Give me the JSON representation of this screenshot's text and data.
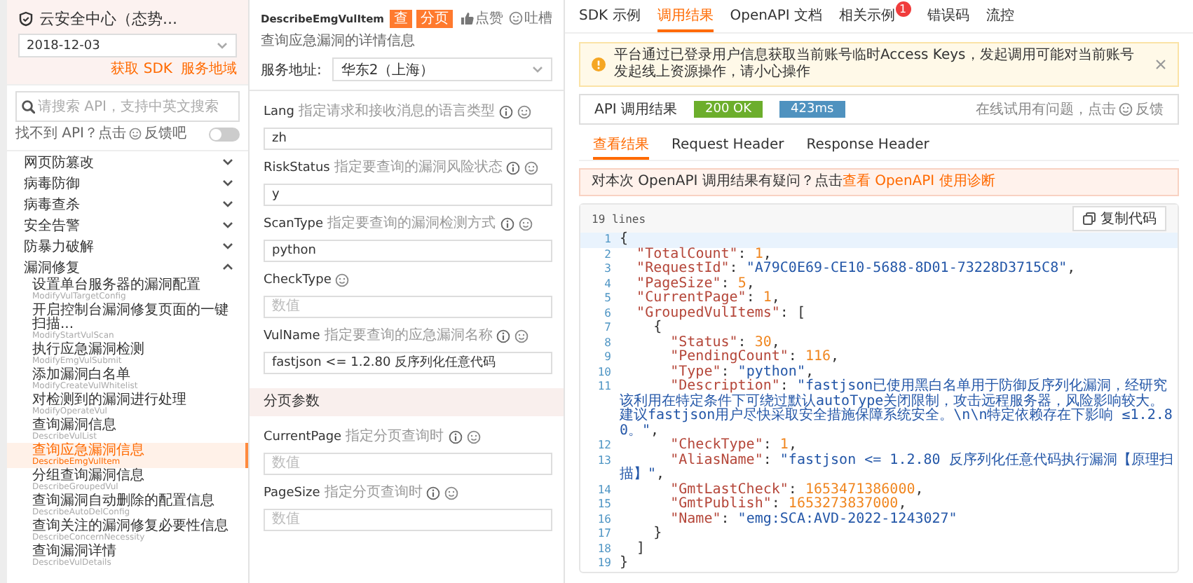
{
  "sidebar": {
    "title": "云安全中心（态势...",
    "version": "2018-12-03",
    "links": [
      "获取 SDK",
      "服务地域"
    ],
    "search": {
      "placeholder": "请搜索 API，支持中英文搜索"
    },
    "hint": {
      "text": "找不到 API？点击",
      "link": "反馈吧"
    },
    "mode_toggle_on": false,
    "categories": [
      {
        "name": "网页防篡改",
        "expanded": false
      },
      {
        "name": "病毒防御",
        "expanded": false
      },
      {
        "name": "病毒查杀",
        "expanded": false
      },
      {
        "name": "安全告警",
        "expanded": false
      },
      {
        "name": "防暴力破解",
        "expanded": false
      },
      {
        "name": "漏洞修复",
        "expanded": true,
        "children": [
          {
            "name": "设置单台服务器的漏洞配置",
            "api": "ModifyVulTargetConfig",
            "selected": false
          },
          {
            "name": "开启控制台漏洞修复页面的一键扫描...",
            "api": "ModifyStartVulScan",
            "selected": false
          },
          {
            "name": "执行应急漏洞检测",
            "api": "ModifyEmgVulSubmit",
            "selected": false
          },
          {
            "name": "添加漏洞白名单",
            "api": "ModifyCreateVulWhitelist",
            "selected": false
          },
          {
            "name": "对检测到的漏洞进行处理",
            "api": "ModifyOperateVul",
            "selected": false
          },
          {
            "name": "查询漏洞信息",
            "api": "DescribeVulList",
            "selected": false
          },
          {
            "name": "查询应急漏洞信息",
            "api": "DescribeEmgVulItem",
            "selected": true
          },
          {
            "name": "分组查询漏洞信息",
            "api": "DescribeGroupedVul",
            "selected": false
          },
          {
            "name": "查询漏洞自动删除的配置信息",
            "api": "DescribeAutoDelConfig",
            "selected": false
          },
          {
            "name": "查询关注的漏洞修复必要性信息",
            "api": "DescribeConcernNecessity",
            "selected": false
          },
          {
            "name": "查询漏洞详情",
            "api": "DescribeVulDetails",
            "selected": false
          }
        ]
      }
    ]
  },
  "api": {
    "name": "DescribeEmgVulItem",
    "tags": [
      "查",
      "分页"
    ],
    "actions": [
      {
        "kind": "like",
        "label": "点赞"
      },
      {
        "kind": "complain",
        "label": "吐槽"
      }
    ],
    "description": "查询应急漏洞的详情信息",
    "endpoint": {
      "label": "服务地址:",
      "value": "华东2（上海）"
    },
    "params": [
      {
        "name": "Lang",
        "description": "指定请求和接收消息的语言类型",
        "info": true,
        "value": "zh"
      },
      {
        "name": "RiskStatus",
        "description": "指定要查询的漏洞风险状态",
        "info": true,
        "value": "y"
      },
      {
        "name": "ScanType",
        "description": "指定要查询的漏洞检测方式",
        "info": true,
        "value": "python"
      },
      {
        "name": "CheckType",
        "info": false,
        "placeholder": "数值"
      },
      {
        "name": "VulName",
        "description": "指定要查询的应急漏洞名称",
        "info": true,
        "value": "fastjson <= 1.2.80 反序列化任意代码"
      }
    ],
    "paging": {
      "title": "分页参数",
      "params": [
        {
          "name": "CurrentPage",
          "description": "指定分页查询时",
          "info": true,
          "placeholder": "数值"
        },
        {
          "name": "PageSize",
          "description": "指定分页查询时",
          "info": true,
          "placeholder": "数值"
        }
      ]
    }
  },
  "result": {
    "tabs": [
      {
        "label": "SDK 示例",
        "selected": false
      },
      {
        "label": "调用结果",
        "selected": true
      },
      {
        "label": "OpenAPI 文档",
        "selected": false
      },
      {
        "label": "相关示例",
        "selected": false,
        "badge": "1"
      },
      {
        "label": "错误码",
        "selected": false
      },
      {
        "label": "流控",
        "selected": false
      }
    ],
    "notice": "平台通过已登录用户信息获取当前账号临时Access Keys，发起调用可能对当前账号发起线上资源操作，请小心操作",
    "call": {
      "label": "API 调用结果",
      "status": "200 OK",
      "duration": "423ms",
      "feedback_text": "在线试用有问题，点击",
      "feedback_link": "反馈"
    },
    "subtabs": [
      {
        "label": "查看结果",
        "selected": true
      },
      {
        "label": "Request Header",
        "selected": false
      },
      {
        "label": "Response Header",
        "selected": false
      }
    ],
    "diagnosis": {
      "text": "对本次 OpenAPI 调用结果有疑问？点击",
      "link": "查看 OpenAPI 使用诊断"
    },
    "code": {
      "line_count": "19 lines",
      "copy_button": "复制代码",
      "lines": [
        {
          "number": "1",
          "highlighted": true,
          "tokens": [
            {
              "kind": "punct",
              "text": "{"
            }
          ]
        },
        {
          "number": "2",
          "highlighted": false,
          "tokens": [
            {
              "kind": "key",
              "text": "  \"TotalCount\""
            },
            {
              "kind": "punct",
              "text": ": "
            },
            {
              "kind": "number",
              "text": "1"
            },
            {
              "kind": "punct",
              "text": ","
            }
          ]
        },
        {
          "number": "3",
          "highlighted": false,
          "tokens": [
            {
              "kind": "key",
              "text": "  \"RequestId\""
            },
            {
              "kind": "punct",
              "text": ": "
            },
            {
              "kind": "string",
              "text": "\"A79C0E69-CE10-5688-8D01-73228D3715C8\""
            },
            {
              "kind": "punct",
              "text": ","
            }
          ]
        },
        {
          "number": "4",
          "highlighted": false,
          "tokens": [
            {
              "kind": "key",
              "text": "  \"PageSize\""
            },
            {
              "kind": "punct",
              "text": ": "
            },
            {
              "kind": "number",
              "text": "5"
            },
            {
              "kind": "punct",
              "text": ","
            }
          ]
        },
        {
          "number": "5",
          "highlighted": false,
          "tokens": [
            {
              "kind": "key",
              "text": "  \"CurrentPage\""
            },
            {
              "kind": "punct",
              "text": ": "
            },
            {
              "kind": "number",
              "text": "1"
            },
            {
              "kind": "punct",
              "text": ","
            }
          ]
        },
        {
          "number": "6",
          "highlighted": false,
          "tokens": [
            {
              "kind": "key",
              "text": "  \"GroupedVulItems\""
            },
            {
              "kind": "punct",
              "text": ": ["
            }
          ]
        },
        {
          "number": "7",
          "highlighted": false,
          "tokens": [
            {
              "kind": "punct",
              "text": "    {"
            }
          ]
        },
        {
          "number": "8",
          "highlighted": false,
          "tokens": [
            {
              "kind": "key",
              "text": "      \"Status\""
            },
            {
              "kind": "punct",
              "text": ": "
            },
            {
              "kind": "number",
              "text": "30"
            },
            {
              "kind": "punct",
              "text": ","
            }
          ]
        },
        {
          "number": "9",
          "highlighted": false,
          "tokens": [
            {
              "kind": "key",
              "text": "      \"PendingCount\""
            },
            {
              "kind": "punct",
              "text": ": "
            },
            {
              "kind": "number",
              "text": "116"
            },
            {
              "kind": "punct",
              "text": ","
            }
          ]
        },
        {
          "number": "10",
          "highlighted": false,
          "tokens": [
            {
              "kind": "key",
              "text": "      \"Type\""
            },
            {
              "kind": "punct",
              "text": ": "
            },
            {
              "kind": "string",
              "text": "\"python\""
            },
            {
              "kind": "punct",
              "text": ","
            }
          ]
        },
        {
          "number": "11",
          "highlighted": false,
          "tokens": [
            {
              "kind": "key",
              "text": "      \"Description\""
            },
            {
              "kind": "punct",
              "text": ": "
            },
            {
              "kind": "string",
              "text": "\"fastjson已使用黑白名单用于防御反序列化漏洞，经研究该利用在特定条件下可绕过默认autoType关闭限制，攻击远程服务器，风险影响较大。建议fastjson用户尽快采取安全措施保障系统安全。\\n\\n特定依赖存在下影响 ≤1.2.80。\""
            },
            {
              "kind": "punct",
              "text": ","
            }
          ]
        },
        {
          "number": "12",
          "highlighted": false,
          "tokens": [
            {
              "kind": "key",
              "text": "      \"CheckType\""
            },
            {
              "kind": "punct",
              "text": ": "
            },
            {
              "kind": "number",
              "text": "1"
            },
            {
              "kind": "punct",
              "text": ","
            }
          ]
        },
        {
          "number": "13",
          "highlighted": false,
          "tokens": [
            {
              "kind": "key",
              "text": "      \"AliasName\""
            },
            {
              "kind": "punct",
              "text": ": "
            },
            {
              "kind": "string",
              "text": "\"fastjson <= 1.2.80 反序列化任意代码执行漏洞【原理扫描】\""
            },
            {
              "kind": "punct",
              "text": ","
            }
          ]
        },
        {
          "number": "14",
          "highlighted": false,
          "tokens": [
            {
              "kind": "key",
              "text": "      \"GmtLastCheck\""
            },
            {
              "kind": "punct",
              "text": ": "
            },
            {
              "kind": "number",
              "text": "1653471386000"
            },
            {
              "kind": "punct",
              "text": ","
            }
          ]
        },
        {
          "number": "15",
          "highlighted": false,
          "tokens": [
            {
              "kind": "key",
              "text": "      \"GmtPublish\""
            },
            {
              "kind": "punct",
              "text": ": "
            },
            {
              "kind": "number",
              "text": "1653273837000"
            },
            {
              "kind": "punct",
              "text": ","
            }
          ]
        },
        {
          "number": "16",
          "highlighted": false,
          "tokens": [
            {
              "kind": "key",
              "text": "      \"Name\""
            },
            {
              "kind": "punct",
              "text": ": "
            },
            {
              "kind": "string",
              "text": "\"emg:SCA:AVD-2022-1243027\""
            }
          ]
        },
        {
          "number": "17",
          "highlighted": false,
          "tokens": [
            {
              "kind": "punct",
              "text": "    }"
            }
          ]
        },
        {
          "number": "18",
          "highlighted": false,
          "tokens": [
            {
              "kind": "punct",
              "text": "  ]"
            }
          ]
        },
        {
          "number": "19",
          "highlighted": false,
          "tokens": [
            {
              "kind": "punct",
              "text": "}"
            }
          ]
        }
      ]
    }
  }
}
